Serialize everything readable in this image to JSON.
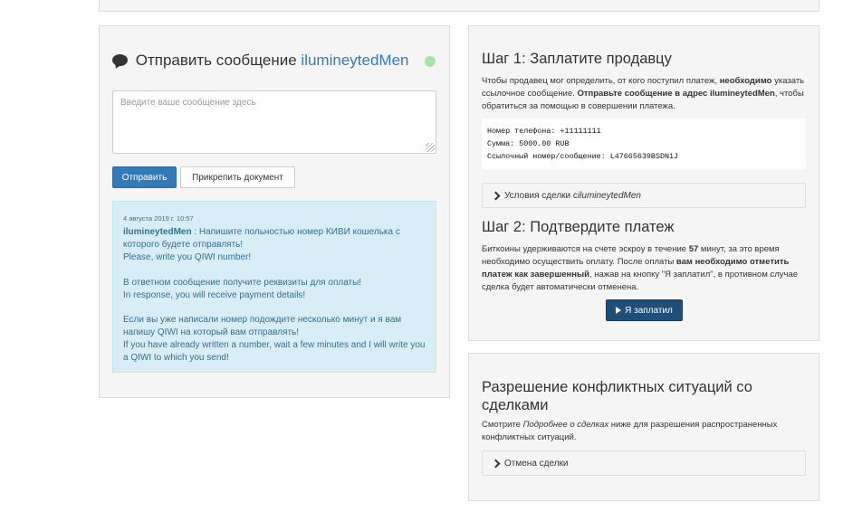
{
  "chat": {
    "title_prefix": "Отправить сообщение",
    "username": "ilumineytedMen",
    "input_placeholder": "Введите ваше сообщение здесь",
    "send_label": "Отправить",
    "attach_label": "Прикрепить документ",
    "message": {
      "date": "4 августа 2019 г. 10:57",
      "author": "ilumineytedMen",
      "lines": [
        " : Напишите польностью номер КИВИ кошелька с которого будете отправлять!",
        "Please, write you QIWI number!",
        "В ответном сообщение получите реквизиты для оплаты!",
        "In response, you will receive payment details!",
        "Если вы уже написали номер подождите несколько минут и я вам напишу QIWI на который вам отправлять!",
        "If you have already written a number, wait a few minutes and I will write you a QIWI to which you send!"
      ]
    }
  },
  "step1": {
    "title": "Шаг 1: Заплатите продавцу",
    "text_a": "Чтобы продавец мог определить, от кого поступил платеж, ",
    "text_b": "необходимо",
    "text_c": " указать ссылочное сообщение. ",
    "text_d": "Отправьте сообщение в адрес ilumineytedMen",
    "text_e": ", чтобы обратиться за помощью в совершении платежа.",
    "payment": {
      "phone": "Номер телефона: +11111111",
      "amount": "Сумма: 5000.00 RUB",
      "reference": "Ссылочный номер/сообщение: L47665639BSDN1J"
    },
    "terms_label": "Условия сделки с ",
    "terms_user": "ilumineytedMen"
  },
  "step2": {
    "title": "Шаг 2: Подтвердите платеж",
    "text_a": "Биткоины удерживаются на счете эскроу в течение ",
    "minutes": "57",
    "text_b": " минут, за это время необходимо осуществить оплату. После оплаты ",
    "text_c": "вам необходимо отметить платеж как завершенный",
    "text_d": ", нажав на кнопку \"Я заплатил\", в противном случае сделка будет автоматически отменена.",
    "paid_label": "Я заплатил"
  },
  "disputes": {
    "title": "Разрешение конфликтных ситуаций со сделками",
    "text_a": "Смотрите ",
    "text_em": "Подробнее о сделках",
    "text_b": " ниже для разрешения распространенных конфликтных ситуаций.",
    "cancel_label": "Отмена сделки"
  },
  "colors": {
    "primary": "#337ab7",
    "online": "#a6e5a6",
    "message_bg": "#d9edf7",
    "message_text": "#31708f"
  }
}
